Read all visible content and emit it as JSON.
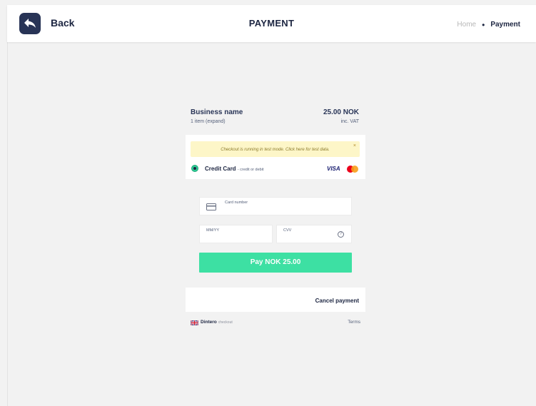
{
  "header": {
    "back_label": "Back",
    "title": "PAYMENT",
    "breadcrumb": {
      "home": "Home",
      "separator": "•",
      "current": "Payment"
    }
  },
  "summary": {
    "business_name": "Business name",
    "items": "1 item (expand)",
    "amount": "25.00 NOK",
    "vat_note": "inc. VAT"
  },
  "test_banner": {
    "text": "Checkout is running in test mode. Click here for test data.",
    "close": "×"
  },
  "payment_method": {
    "label": "Credit Card",
    "sublabel": "- credit or debit",
    "brands": [
      "VISA",
      "mastercard"
    ],
    "selected": true
  },
  "form": {
    "card_number_placeholder": "Card number",
    "expiry_placeholder": "MM/YY",
    "cvv_placeholder": "CVV",
    "help_glyph": "?"
  },
  "pay_button": "Pay NOK 25.00",
  "cancel_link": "Cancel payment",
  "footer": {
    "brand": "Dintero",
    "brand_sub": "checkout",
    "terms": "Terms"
  },
  "colors": {
    "accent": "#3de0a3",
    "navy": "#283456",
    "banner": "#fdf6c8"
  }
}
